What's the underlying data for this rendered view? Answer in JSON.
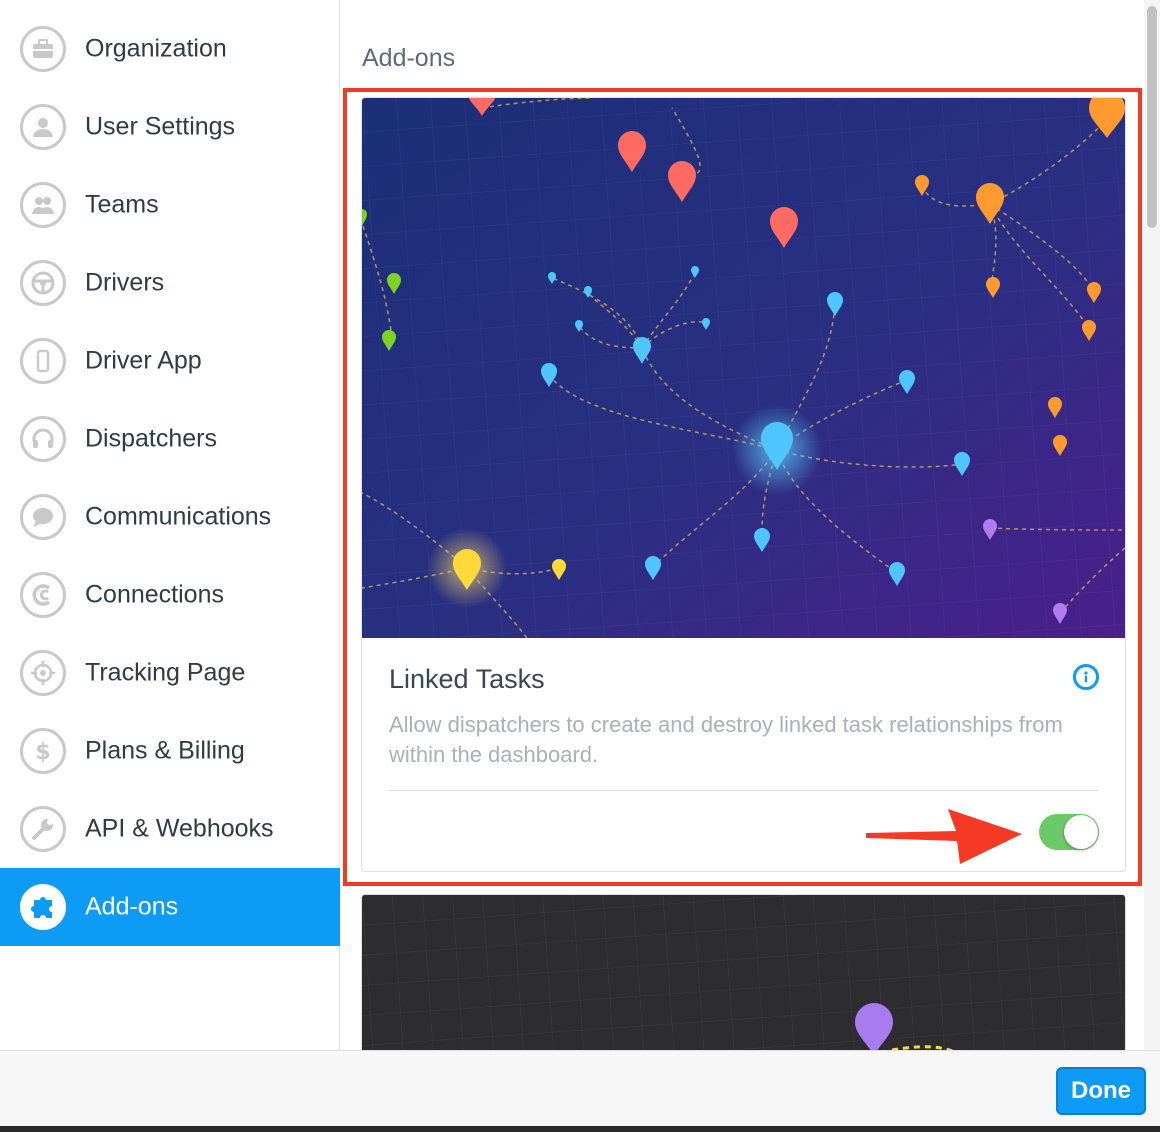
{
  "sidebar": {
    "items": [
      {
        "label": "Organization",
        "icon": "briefcase-icon"
      },
      {
        "label": "User Settings",
        "icon": "user-icon"
      },
      {
        "label": "Teams",
        "icon": "team-icon"
      },
      {
        "label": "Drivers",
        "icon": "steering-wheel-icon"
      },
      {
        "label": "Driver App",
        "icon": "phone-icon"
      },
      {
        "label": "Dispatchers",
        "icon": "headset-icon"
      },
      {
        "label": "Communications",
        "icon": "chat-bubble-icon"
      },
      {
        "label": "Connections",
        "icon": "connection-icon"
      },
      {
        "label": "Tracking Page",
        "icon": "target-icon"
      },
      {
        "label": "Plans & Billing",
        "icon": "dollar-icon"
      },
      {
        "label": "API & Webhooks",
        "icon": "wrench-icon"
      },
      {
        "label": "Add-ons",
        "icon": "puzzle-icon",
        "active": true
      }
    ]
  },
  "main": {
    "section_title": "Add-ons",
    "addon": {
      "title": "Linked Tasks",
      "description": "Allow dispatchers to create and destroy linked task relationships from within the dashboard.",
      "enabled": true
    }
  },
  "footer": {
    "done_label": "Done"
  },
  "colors": {
    "accent": "#0d9bf5",
    "highlight": "#f43a24",
    "toggle_on": "#6cc968"
  }
}
